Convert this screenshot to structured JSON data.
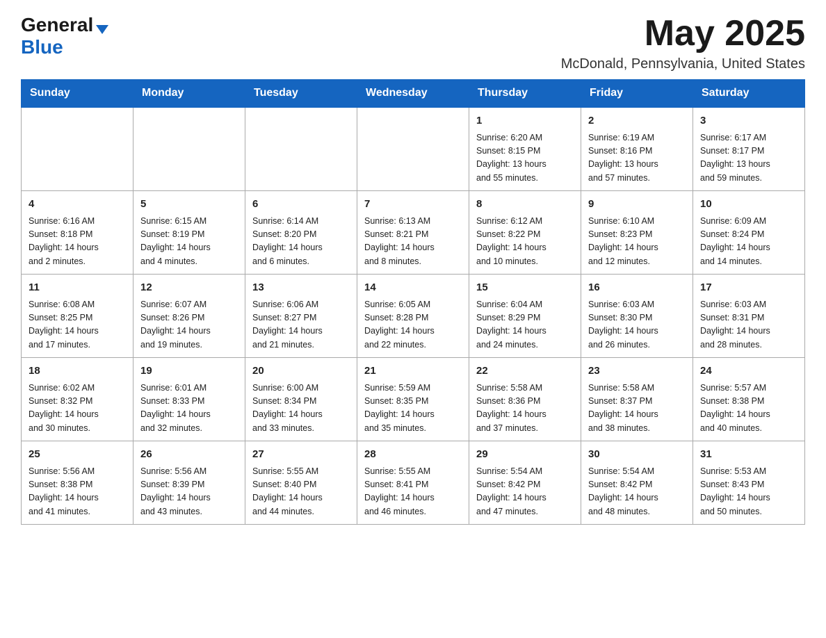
{
  "header": {
    "logo": {
      "general": "General",
      "blue": "Blue",
      "arrow": "▼"
    },
    "title": "May 2025",
    "location": "McDonald, Pennsylvania, United States"
  },
  "calendar": {
    "days_of_week": [
      "Sunday",
      "Monday",
      "Tuesday",
      "Wednesday",
      "Thursday",
      "Friday",
      "Saturday"
    ],
    "weeks": [
      [
        {
          "day": "",
          "info": ""
        },
        {
          "day": "",
          "info": ""
        },
        {
          "day": "",
          "info": ""
        },
        {
          "day": "",
          "info": ""
        },
        {
          "day": "1",
          "info": "Sunrise: 6:20 AM\nSunset: 8:15 PM\nDaylight: 13 hours\nand 55 minutes."
        },
        {
          "day": "2",
          "info": "Sunrise: 6:19 AM\nSunset: 8:16 PM\nDaylight: 13 hours\nand 57 minutes."
        },
        {
          "day": "3",
          "info": "Sunrise: 6:17 AM\nSunset: 8:17 PM\nDaylight: 13 hours\nand 59 minutes."
        }
      ],
      [
        {
          "day": "4",
          "info": "Sunrise: 6:16 AM\nSunset: 8:18 PM\nDaylight: 14 hours\nand 2 minutes."
        },
        {
          "day": "5",
          "info": "Sunrise: 6:15 AM\nSunset: 8:19 PM\nDaylight: 14 hours\nand 4 minutes."
        },
        {
          "day": "6",
          "info": "Sunrise: 6:14 AM\nSunset: 8:20 PM\nDaylight: 14 hours\nand 6 minutes."
        },
        {
          "day": "7",
          "info": "Sunrise: 6:13 AM\nSunset: 8:21 PM\nDaylight: 14 hours\nand 8 minutes."
        },
        {
          "day": "8",
          "info": "Sunrise: 6:12 AM\nSunset: 8:22 PM\nDaylight: 14 hours\nand 10 minutes."
        },
        {
          "day": "9",
          "info": "Sunrise: 6:10 AM\nSunset: 8:23 PM\nDaylight: 14 hours\nand 12 minutes."
        },
        {
          "day": "10",
          "info": "Sunrise: 6:09 AM\nSunset: 8:24 PM\nDaylight: 14 hours\nand 14 minutes."
        }
      ],
      [
        {
          "day": "11",
          "info": "Sunrise: 6:08 AM\nSunset: 8:25 PM\nDaylight: 14 hours\nand 17 minutes."
        },
        {
          "day": "12",
          "info": "Sunrise: 6:07 AM\nSunset: 8:26 PM\nDaylight: 14 hours\nand 19 minutes."
        },
        {
          "day": "13",
          "info": "Sunrise: 6:06 AM\nSunset: 8:27 PM\nDaylight: 14 hours\nand 21 minutes."
        },
        {
          "day": "14",
          "info": "Sunrise: 6:05 AM\nSunset: 8:28 PM\nDaylight: 14 hours\nand 22 minutes."
        },
        {
          "day": "15",
          "info": "Sunrise: 6:04 AM\nSunset: 8:29 PM\nDaylight: 14 hours\nand 24 minutes."
        },
        {
          "day": "16",
          "info": "Sunrise: 6:03 AM\nSunset: 8:30 PM\nDaylight: 14 hours\nand 26 minutes."
        },
        {
          "day": "17",
          "info": "Sunrise: 6:03 AM\nSunset: 8:31 PM\nDaylight: 14 hours\nand 28 minutes."
        }
      ],
      [
        {
          "day": "18",
          "info": "Sunrise: 6:02 AM\nSunset: 8:32 PM\nDaylight: 14 hours\nand 30 minutes."
        },
        {
          "day": "19",
          "info": "Sunrise: 6:01 AM\nSunset: 8:33 PM\nDaylight: 14 hours\nand 32 minutes."
        },
        {
          "day": "20",
          "info": "Sunrise: 6:00 AM\nSunset: 8:34 PM\nDaylight: 14 hours\nand 33 minutes."
        },
        {
          "day": "21",
          "info": "Sunrise: 5:59 AM\nSunset: 8:35 PM\nDaylight: 14 hours\nand 35 minutes."
        },
        {
          "day": "22",
          "info": "Sunrise: 5:58 AM\nSunset: 8:36 PM\nDaylight: 14 hours\nand 37 minutes."
        },
        {
          "day": "23",
          "info": "Sunrise: 5:58 AM\nSunset: 8:37 PM\nDaylight: 14 hours\nand 38 minutes."
        },
        {
          "day": "24",
          "info": "Sunrise: 5:57 AM\nSunset: 8:38 PM\nDaylight: 14 hours\nand 40 minutes."
        }
      ],
      [
        {
          "day": "25",
          "info": "Sunrise: 5:56 AM\nSunset: 8:38 PM\nDaylight: 14 hours\nand 41 minutes."
        },
        {
          "day": "26",
          "info": "Sunrise: 5:56 AM\nSunset: 8:39 PM\nDaylight: 14 hours\nand 43 minutes."
        },
        {
          "day": "27",
          "info": "Sunrise: 5:55 AM\nSunset: 8:40 PM\nDaylight: 14 hours\nand 44 minutes."
        },
        {
          "day": "28",
          "info": "Sunrise: 5:55 AM\nSunset: 8:41 PM\nDaylight: 14 hours\nand 46 minutes."
        },
        {
          "day": "29",
          "info": "Sunrise: 5:54 AM\nSunset: 8:42 PM\nDaylight: 14 hours\nand 47 minutes."
        },
        {
          "day": "30",
          "info": "Sunrise: 5:54 AM\nSunset: 8:42 PM\nDaylight: 14 hours\nand 48 minutes."
        },
        {
          "day": "31",
          "info": "Sunrise: 5:53 AM\nSunset: 8:43 PM\nDaylight: 14 hours\nand 50 minutes."
        }
      ]
    ]
  }
}
